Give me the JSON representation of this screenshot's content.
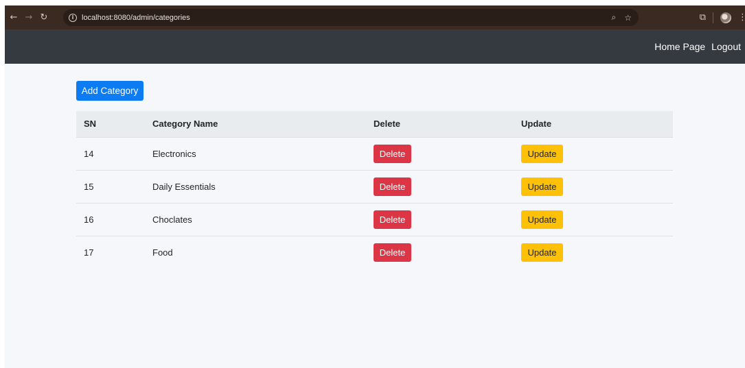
{
  "browser": {
    "url": "localhost:8080/admin/categories",
    "icons": [
      "back-icon",
      "forward-icon",
      "reload-icon",
      "info-icon",
      "zoom-icon",
      "star-icon",
      "extensions-icon",
      "profile-avatar",
      "menu-icon"
    ]
  },
  "navbar": {
    "links": [
      {
        "label": "Home Page"
      },
      {
        "label": "Logout"
      }
    ]
  },
  "main": {
    "add_button_label": "Add Category",
    "table": {
      "headers": [
        "SN",
        "Category Name",
        "Delete",
        "Update"
      ],
      "rows": [
        {
          "sn": "14",
          "name": "Electronics",
          "delete_label": "Delete",
          "update_label": "Update"
        },
        {
          "sn": "15",
          "name": "Daily Essentials",
          "delete_label": "Delete",
          "update_label": "Update"
        },
        {
          "sn": "16",
          "name": "Choclates",
          "delete_label": "Delete",
          "update_label": "Update"
        },
        {
          "sn": "17",
          "name": "Food",
          "delete_label": "Delete",
          "update_label": "Update"
        }
      ]
    }
  },
  "colors": {
    "navbar_bg": "#343a40",
    "primary": "#0d7bf2",
    "danger": "#dc3545",
    "warning": "#ffc107",
    "page_bg": "#f5f7fa"
  }
}
